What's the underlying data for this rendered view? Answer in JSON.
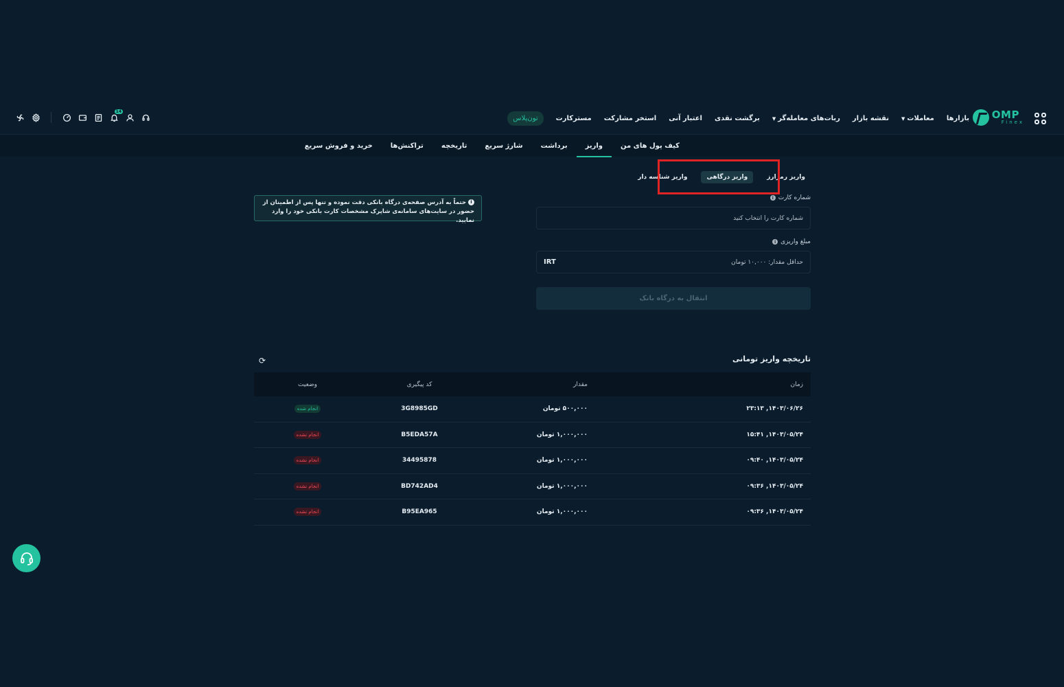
{
  "header": {
    "logo": {
      "brand": "OMP",
      "sub": "Finex"
    },
    "nav": [
      {
        "label": "بازارها",
        "caret": false
      },
      {
        "label": "معاملات",
        "caret": true
      },
      {
        "label": "نقشه بازار",
        "caret": false
      },
      {
        "label": "ربات‌های معامله‌گر",
        "caret": true
      },
      {
        "label": "برگشت نقدی",
        "caret": false
      },
      {
        "label": "اعتبار آنی",
        "caret": false
      },
      {
        "label": "استخر مشارکت",
        "caret": false
      },
      {
        "label": "مسترکارت",
        "caret": false
      }
    ],
    "highlight": "تون‌پلاس",
    "notifications_badge": "14"
  },
  "subnav": {
    "tabs": [
      "کیف پول های من",
      "واریز",
      "برداشت",
      "شارژ سریع",
      "تاریخچه",
      "تراکنش‌ها",
      "خرید و فروش سریع"
    ],
    "active_index": 1
  },
  "deposit": {
    "methods": [
      "واریز رمزارز",
      "واریز درگاهی",
      "واریز شناسه دار"
    ],
    "active_method_index": 1,
    "card_label": "شماره کارت",
    "card_placeholder": "شماره کارت را انتخاب کنید",
    "amount_label": "مبلغ واریزی",
    "amount_placeholder": "حداقل مقدار: ۱۰,۰۰۰ تومان",
    "currency": "IRT",
    "submit_label": "انتقال به درگاه بانک",
    "notice": "حتماً به آدرس صفحه‌ی درگاه بانکی دقت نموده و تنها پس از اطمینان از حضور در سایت‌های سامانه‌ی شاپرک مشخصات کارت بانکی خود را وارد نمایید."
  },
  "history": {
    "title": "تاریخچه واریز تومانی",
    "columns": [
      "زمان",
      "مقدار",
      "کد پیگیری",
      "وضعیت"
    ],
    "rows": [
      {
        "time": "۱۴۰۳/۰۶/۲۶, ۲۳:۱۳",
        "amount": "۵۰۰,۰۰۰ تومان",
        "code": "3G8985GD",
        "status": "انجام شده",
        "ok": true
      },
      {
        "time": "۱۴۰۳/۰۵/۲۴, ۱۵:۴۱",
        "amount": "۱,۰۰۰,۰۰۰ تومان",
        "code": "B5EDA57A",
        "status": "انجام نشده",
        "ok": false
      },
      {
        "time": "۱۴۰۳/۰۵/۲۴, ۰۹:۴۰",
        "amount": "۱,۰۰۰,۰۰۰ تومان",
        "code": "34495878",
        "status": "انجام نشده",
        "ok": false
      },
      {
        "time": "۱۴۰۳/۰۵/۲۴, ۰۹:۳۶",
        "amount": "۱,۰۰۰,۰۰۰ تومان",
        "code": "BD742AD4",
        "status": "انجام نشده",
        "ok": false
      },
      {
        "time": "۱۴۰۳/۰۵/۲۴, ۰۹:۳۶",
        "amount": "۱,۰۰۰,۰۰۰ تومان",
        "code": "B95EA965",
        "status": "انجام نشده",
        "ok": false
      }
    ]
  },
  "colors": {
    "accent": "#25c2a0",
    "background": "#0b1d2d",
    "danger": "#f14a5c",
    "highlight_box": "#e02424"
  },
  "icons": [
    "apps-grid-icon",
    "logo-icon",
    "support-headset-icon",
    "user-icon",
    "bell-icon",
    "receipt-icon",
    "wallet-icon",
    "gauge-icon",
    "settings-icon",
    "fan-icon",
    "refresh-icon"
  ]
}
